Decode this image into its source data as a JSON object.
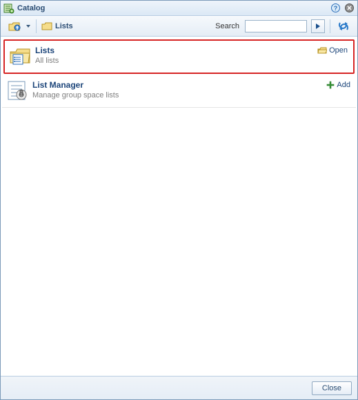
{
  "title": "Catalog",
  "search": {
    "label": "Search",
    "placeholder": ""
  },
  "breadcrumb": {
    "current": "Lists"
  },
  "items": [
    {
      "title": "Lists",
      "desc": "All lists",
      "action_label": "Open"
    },
    {
      "title": "List Manager",
      "desc": "Manage group space lists",
      "action_label": "Add"
    }
  ],
  "footer": {
    "close_label": "Close"
  }
}
